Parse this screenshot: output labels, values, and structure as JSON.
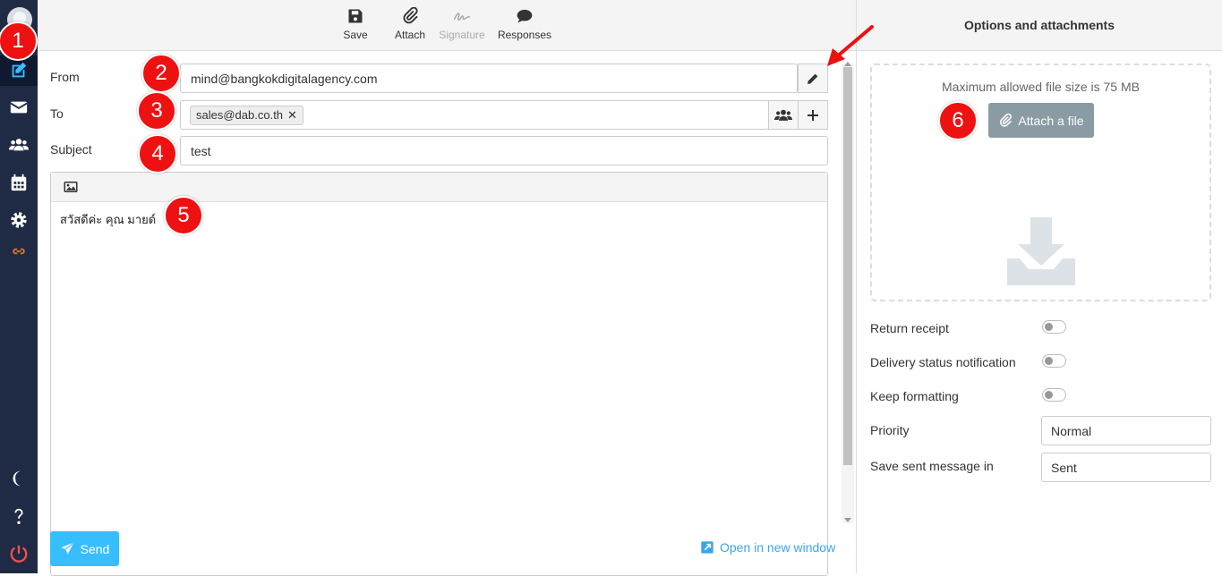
{
  "toolbar": {
    "save": "Save",
    "attach": "Attach",
    "signature": "Signature",
    "responses": "Responses"
  },
  "form": {
    "from_label": "From",
    "from_value": "mind@bangkokdigitalagency.com",
    "to_label": "To",
    "to_recipient": "sales@dab.co.th",
    "subject_label": "Subject",
    "subject_value": "test",
    "body_text": "สวัสดีค่ะ คุณ มายด์"
  },
  "footer": {
    "send": "Send",
    "open_new_window": "Open in new window"
  },
  "options": {
    "title": "Options and attachments",
    "max_size": "Maximum allowed file size is 75 MB",
    "attach_file": "Attach a file",
    "return_receipt": "Return receipt",
    "delivery_status": "Delivery status notification",
    "keep_formatting": "Keep formatting",
    "priority_label": "Priority",
    "priority_value": "Normal",
    "save_sent_label": "Save sent message in",
    "save_sent_value": "Sent"
  },
  "markers": [
    "1",
    "2",
    "3",
    "4",
    "5",
    "6"
  ],
  "colors": {
    "nav_bg": "#1f2a44",
    "accent": "#37beff",
    "marker": "#ee1111",
    "attach_button": "#8a9ba4"
  }
}
